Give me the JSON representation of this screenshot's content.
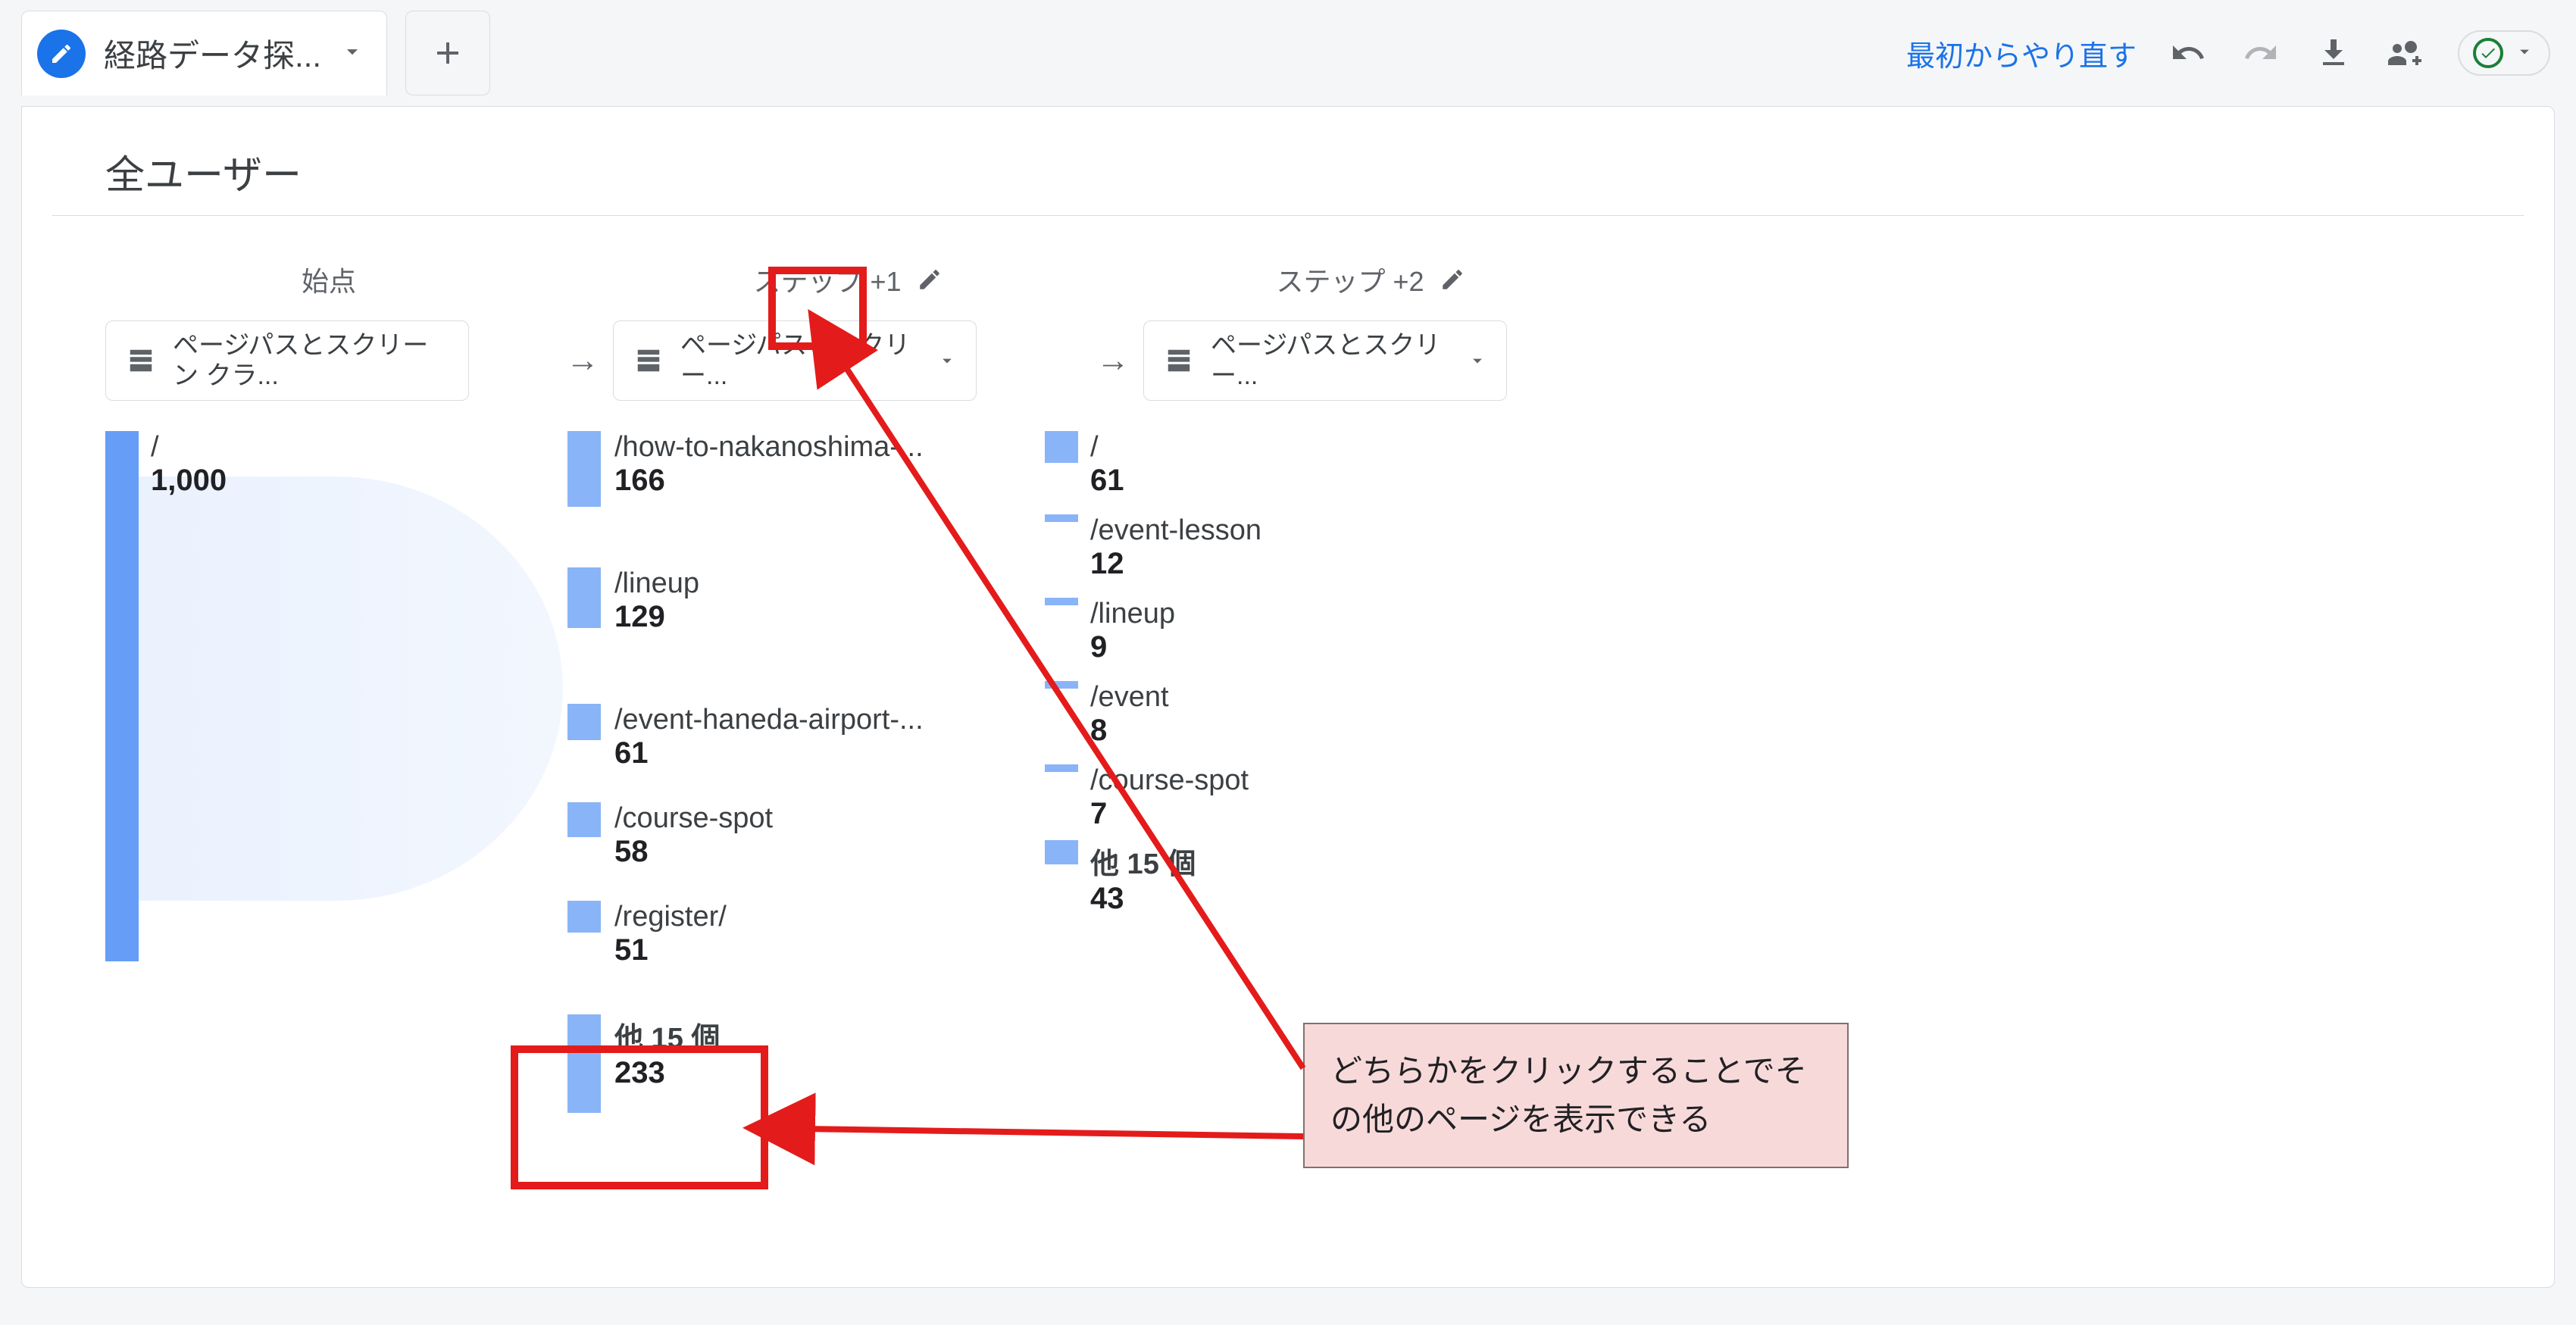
{
  "toolbar": {
    "tab_title": "経路データ探...",
    "restart_label": "最初からやり直す"
  },
  "panel": {
    "title": "全ユーザー"
  },
  "columns": {
    "start": {
      "label": "始点",
      "chip": "ページパスとスクリーン クラ..."
    },
    "step1": {
      "label": "ステップ +1",
      "chip": "ページパスとスクリー..."
    },
    "step2": {
      "label": "ステップ +2",
      "chip": "ページパスとスクリー..."
    }
  },
  "start_node": {
    "path": "/",
    "value": "1,000"
  },
  "step1_nodes": [
    {
      "path": "/how-to-nakanoshima-...",
      "value": "166",
      "h": 100
    },
    {
      "path": "/lineup",
      "value": "129",
      "h": 80
    },
    {
      "path": "/event-haneda-airport-...",
      "value": "61",
      "h": 48
    },
    {
      "path": "/course-spot",
      "value": "58",
      "h": 46
    },
    {
      "path": "/register/",
      "value": "51",
      "h": 42
    },
    {
      "path": "他 15 個",
      "value": "233",
      "h": 130,
      "other": true
    }
  ],
  "step2_nodes": [
    {
      "path": "/",
      "value": "61",
      "h": 42
    },
    {
      "path": "/event-lesson",
      "value": "12",
      "h": 10
    },
    {
      "path": "/lineup",
      "value": "9",
      "h": 10
    },
    {
      "path": "/event",
      "value": "8",
      "h": 10
    },
    {
      "path": "/course-spot",
      "value": "7",
      "h": 10
    },
    {
      "path": "他 15 個",
      "value": "43",
      "h": 32,
      "other": true
    }
  ],
  "callout": {
    "text": "どちらかをクリックすることでその他のページを表示できる"
  }
}
